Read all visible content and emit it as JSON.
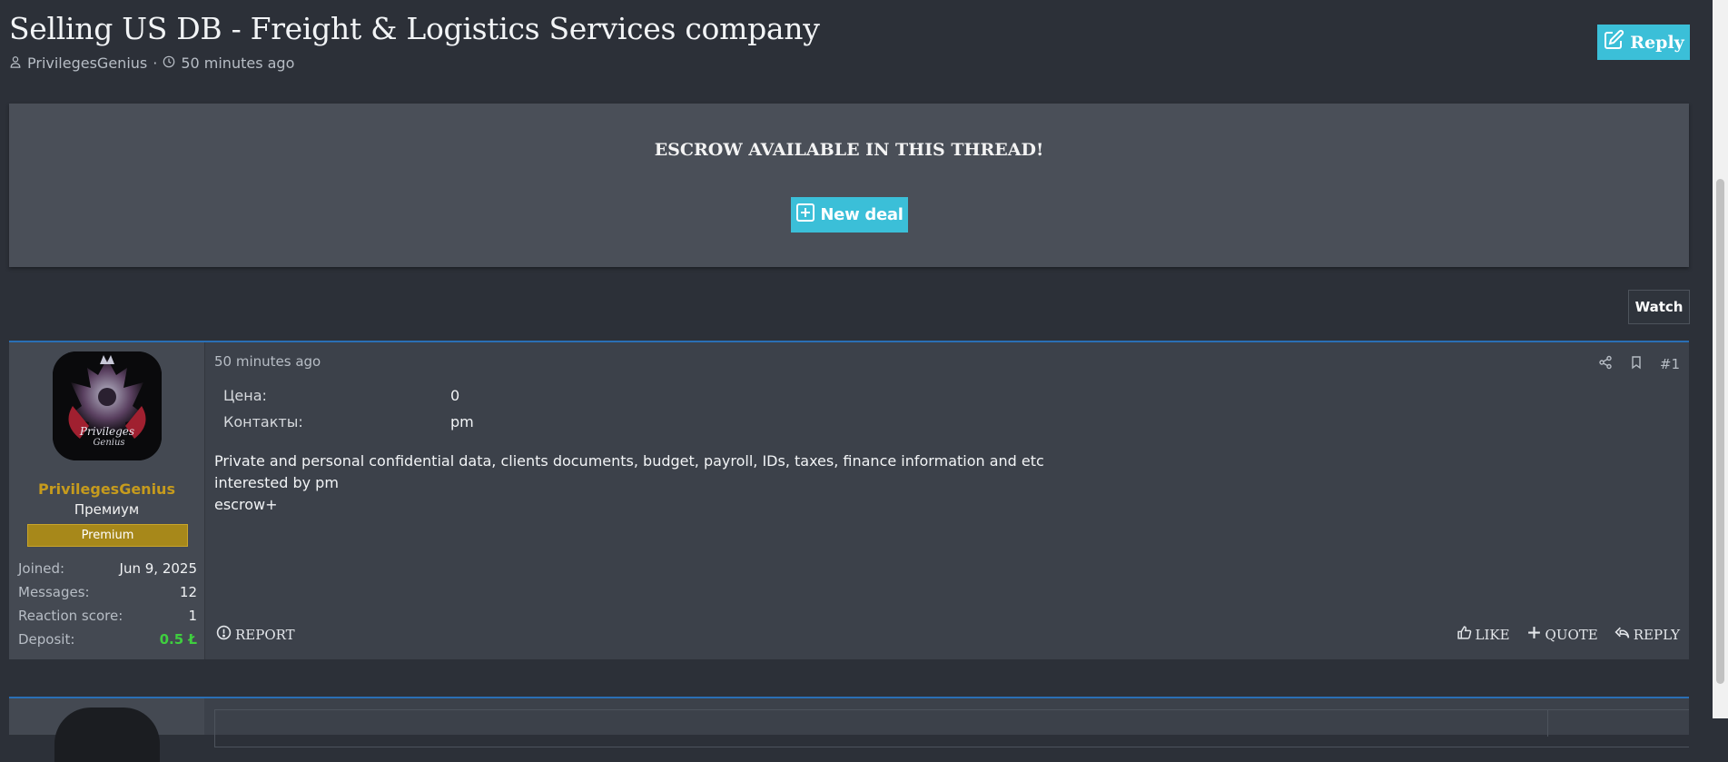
{
  "thread": {
    "title": "Selling US DB - Freight & Logistics Services company",
    "author": "PrivilegesGenius",
    "separator": "·",
    "time": "50 minutes ago",
    "reply_label": "Reply"
  },
  "escrow": {
    "title": "ESCROW AVAILABLE IN THIS THREAD!",
    "new_deal_label": "New deal"
  },
  "watch_label": "Watch",
  "post": {
    "user": {
      "name": "PrivilegesGenius",
      "title": "Премиум",
      "badge": "Premium",
      "avatar_text_1": "Privileges",
      "avatar_text_2": "Genius",
      "stats": [
        {
          "label": "Joined:",
          "value": "Jun 9, 2025"
        },
        {
          "label": "Messages:",
          "value": "12"
        },
        {
          "label": "Reaction score:",
          "value": "1"
        },
        {
          "label": "Deposit:",
          "value": "0.5 Ł"
        }
      ]
    },
    "date": "50 minutes ago",
    "number": "#1",
    "fields": [
      {
        "label": "Цена:",
        "value": "0"
      },
      {
        "label": "Контакты:",
        "value": "pm"
      }
    ],
    "body": [
      "Private and personal confidential data, clients documents, budget, payroll, IDs, taxes, finance information and etc",
      "interested by pm",
      "escrow+"
    ],
    "actions": {
      "report": "REPORT",
      "like": "LIKE",
      "quote": "QUOTE",
      "reply": "REPLY"
    }
  },
  "colors": {
    "accent": "#3bbfd8",
    "username": "#c69b1d",
    "premium_badge": "#a7881a",
    "deposit": "#3fcf3f",
    "post_border": "#2a6fb5"
  }
}
